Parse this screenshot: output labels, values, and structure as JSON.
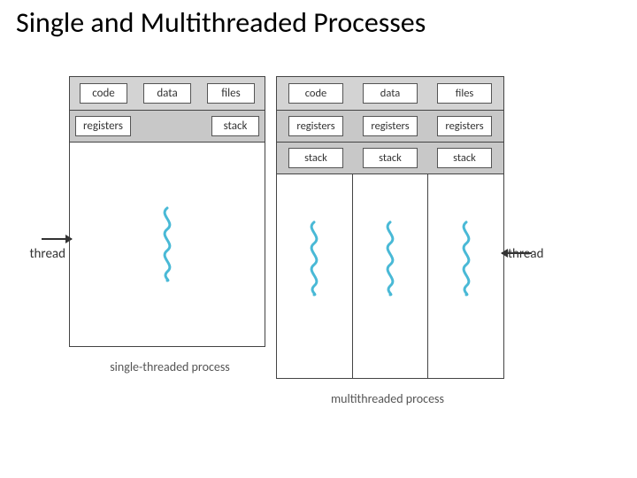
{
  "title": "Single and Multithreaded Processes",
  "thread_label_left": "thread",
  "thread_label_right": "thread",
  "single": {
    "shared": {
      "code": "code",
      "data": "data",
      "files": "files"
    },
    "perthread": {
      "registers": "registers",
      "stack": "stack"
    },
    "caption": "single-threaded process"
  },
  "multi": {
    "shared": {
      "code": "code",
      "data": "data",
      "files": "files"
    },
    "perthread": {
      "registers": [
        "registers",
        "registers",
        "registers"
      ],
      "stack": [
        "stack",
        "stack",
        "stack"
      ]
    },
    "caption": "multithreaded process"
  },
  "colors": {
    "thread_stroke": "#49b9d6"
  }
}
